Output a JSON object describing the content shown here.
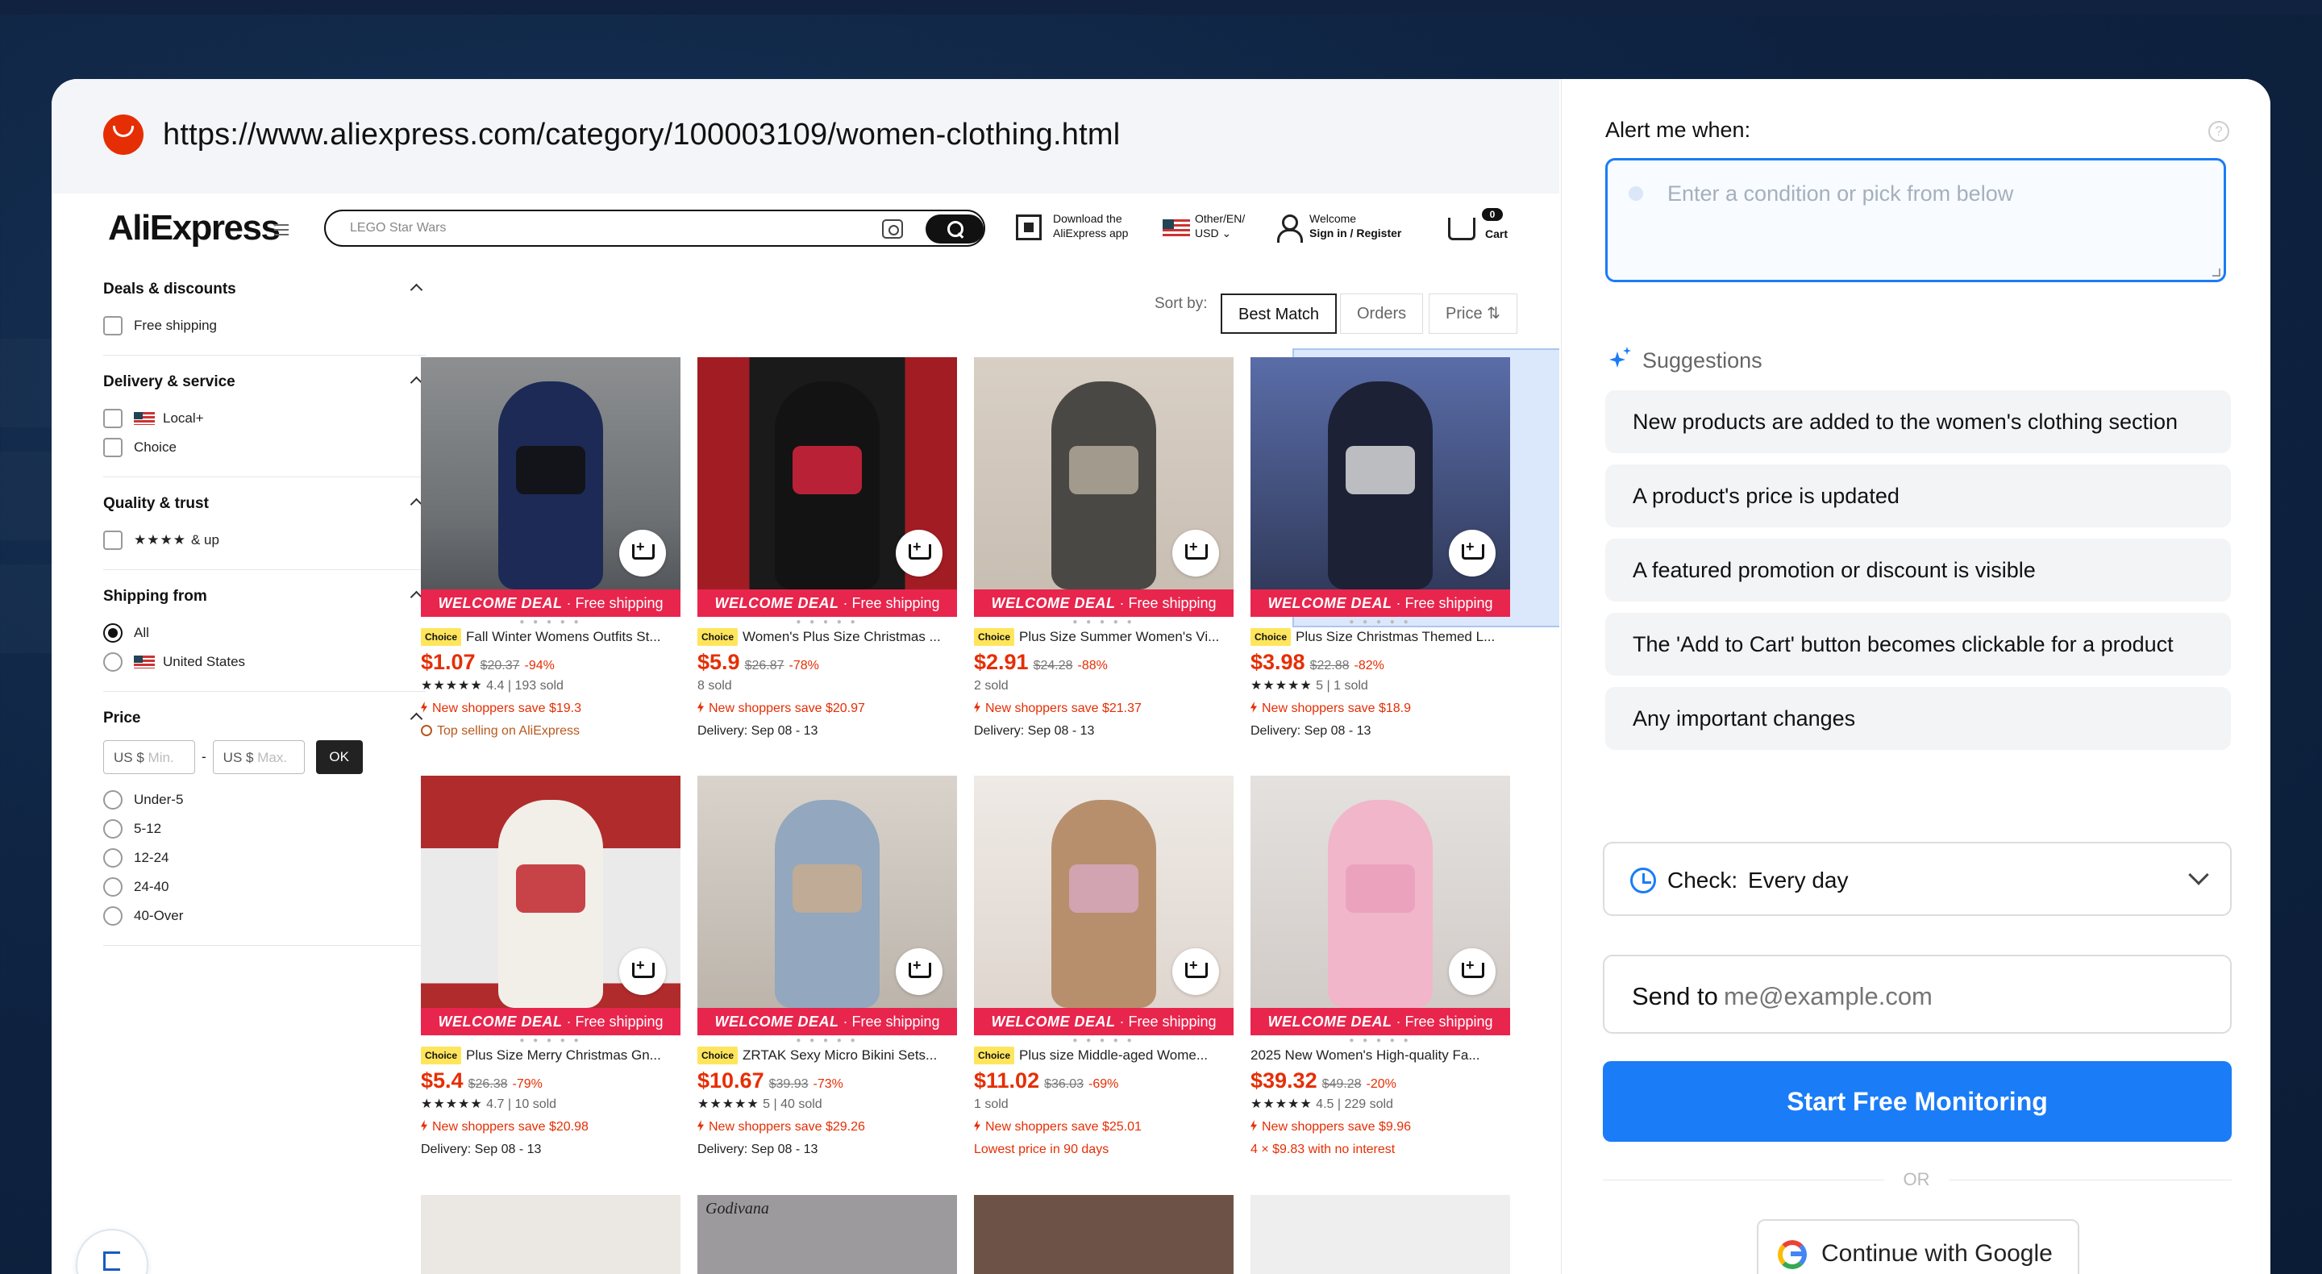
{
  "browser": {
    "url": "https://www.aliexpress.com/category/100003109/women-clothing.html"
  },
  "site": {
    "brand_a": "Ali",
    "brand_b": "Express",
    "search_placeholder": "LEGO Star Wars",
    "app_line1": "Download the",
    "app_line2": "AliExpress app",
    "region_line1": "Other/EN/",
    "region_line2": "USD ⌄",
    "welcome_line1": "Welcome",
    "welcome_line2": "Sign in / Register",
    "cart_label": "Cart",
    "cart_count": "0"
  },
  "filters": {
    "deals_title": "Deals & discounts",
    "free_shipping": "Free shipping",
    "delivery_title": "Delivery & service",
    "local_plus": "Local+",
    "choice": "Choice",
    "quality_title": "Quality & trust",
    "stars": "★★★★",
    "and_up": "& up",
    "shipping_title": "Shipping from",
    "all": "All",
    "united_states": "United States",
    "price_title": "Price",
    "min_prefix": "US $",
    "min_ph": "Min.",
    "dash": "-",
    "max_prefix": "US $",
    "max_ph": "Max.",
    "ok": "OK",
    "ranges": [
      "Under-5",
      "5-12",
      "12-24",
      "24-40",
      "40-Over"
    ]
  },
  "sort": {
    "label": "Sort by:",
    "best_match": "Best Match",
    "orders": "Orders",
    "price": "Price ⇅"
  },
  "products": [
    {
      "badge": "Choice",
      "title": "Fall Winter Womens Outfits St...",
      "price": "$1.07",
      "old": "$20.37",
      "off": "-94%",
      "line1": "★★★★★ 4.4 | 193 sold",
      "line2": "New shoppers save $19.3",
      "line3": "Top selling on AliExpress",
      "welcome_a": "WELCOME DEAL",
      "welcome_b": " · Free shipping"
    },
    {
      "badge": "Choice",
      "title": "Women's Plus Size Christmas ...",
      "price": "$5.9",
      "old": "$26.87",
      "off": "-78%",
      "line1": "8 sold",
      "line2": "New shoppers save $20.97",
      "line3": "Delivery: Sep 08 - 13",
      "welcome_a": "WELCOME DEAL",
      "welcome_b": " · Free shipping"
    },
    {
      "badge": "Choice",
      "title": "Plus Size Summer Women's Vi...",
      "price": "$2.91",
      "old": "$24.28",
      "off": "-88%",
      "line1": "2 sold",
      "line2": "New shoppers save $21.37",
      "line3": "Delivery: Sep 08 - 13",
      "welcome_a": "WELCOME DEAL",
      "welcome_b": " · Free shipping"
    },
    {
      "badge": "Choice",
      "title": "Plus Size Christmas Themed L...",
      "price": "$3.98",
      "old": "$22.88",
      "off": "-82%",
      "line1": "★★★★★ 5 | 1 sold",
      "line2": "New shoppers save $18.9",
      "line3": "Delivery: Sep 08 - 13",
      "welcome_a": "WELCOME DEAL",
      "welcome_b": " · Free shipping"
    },
    {
      "badge": "Choice",
      "title": "Plus Size Merry Christmas Gn...",
      "price": "$5.4",
      "old": "$26.38",
      "off": "-79%",
      "line1": "★★★★★ 4.7 | 10 sold",
      "line2": "New shoppers save $20.98",
      "line3": "Delivery: Sep 08 - 13",
      "welcome_a": "WELCOME DEAL",
      "welcome_b": " · Free shipping"
    },
    {
      "badge": "Choice",
      "title": "ZRTAK Sexy Micro Bikini Sets...",
      "price": "$10.67",
      "old": "$39.93",
      "off": "-73%",
      "line1": "★★★★★ 5 | 40 sold",
      "line2": "New shoppers save $29.26",
      "line3": "Delivery: Sep 08 - 13",
      "welcome_a": "WELCOME DEAL",
      "welcome_b": " · Free shipping"
    },
    {
      "badge": "Choice",
      "title": "Plus size Middle-aged Wome...",
      "price": "$11.02",
      "old": "$36.03",
      "off": "-69%",
      "line1": "1 sold",
      "line2": "New shoppers save $25.01",
      "line3": "Lowest price in 90 days",
      "welcome_a": "WELCOME DEAL",
      "welcome_b": " · Free shipping"
    },
    {
      "badge": "",
      "title": "2025 New Women's High-quality Fa...",
      "price": "$39.32",
      "old": "$49.28",
      "off": "-20%",
      "line1": "★★★★★ 4.5 | 229 sold",
      "line2": "New shoppers save $9.96",
      "line3": "4 × $9.83 with no interest",
      "welcome_a": "WELCOME DEAL",
      "welcome_b": " · Free shipping"
    }
  ],
  "product_thumbs": [
    "Godivana"
  ],
  "monitor": {
    "alert_label": "Alert me when:",
    "help": "?",
    "condition_placeholder": "Enter a condition or pick from below",
    "suggestions_title": "Suggestions",
    "suggestions": [
      "New products are added to the women's clothing section",
      "A product's price is updated",
      "A featured promotion or discount is visible",
      "The 'Add to Cart' button becomes clickable for a product",
      "Any important changes"
    ],
    "check_label": "Check:",
    "check_value": "Every day",
    "send_label": "Send to",
    "send_placeholder": "me@example.com",
    "start_button": "Start Free Monitoring",
    "or": "OR",
    "google_button": "Continue with Google"
  },
  "colors": {
    "accent": "#1a7cf7",
    "aliexpress_red": "#e62e04",
    "welcome_pink": "#e8254d"
  },
  "icons": [
    "aliexpress-logo-icon",
    "search-icon",
    "camera-icon",
    "qr-icon",
    "flag-icon",
    "user-icon",
    "cart-icon",
    "sparkle-icon",
    "clock-icon",
    "chevron-down-icon",
    "google-icon",
    "help-icon",
    "feedback-flag-icon"
  ]
}
